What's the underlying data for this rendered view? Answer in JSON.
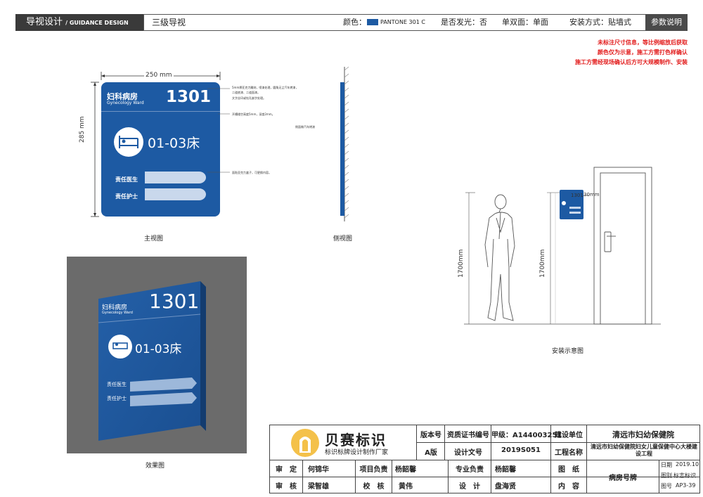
{
  "header": {
    "brand": "导视设计",
    "brand_sub": "/ GUIDANCE DESIGN",
    "page": "三级导视",
    "color_label": "颜色：",
    "pantone": "PANTONE 301 C",
    "glow": "是否发光：否",
    "sides": "单双面：单面",
    "mount": "安装方式：贴墙式",
    "ref_button": "参数说明"
  },
  "notes": [
    "未标注尺寸信息，等比例缩放后获取",
    "颜色仅为示意，施工方需打色样确认",
    "施工方需经现场确认后方可大规模制作、安装"
  ],
  "sign": {
    "dept_cn": "妇科病房",
    "dept_en": "Gynecology Ward",
    "room": "1301",
    "beds": "01-03床",
    "doctor": "责任医生",
    "nurse": "责任护士"
  },
  "front_view": {
    "width_dim": "250 mm",
    "height_dim": "285 mm",
    "caption": "主视图",
    "annotations": [
      "5mm厚亚克力雕刻，喷漆处理，圆角无尘汽车烤漆，",
      "二道底漆、二道面漆。",
      "文字丝印或钻孔嵌字处理。",
      "开槽镂空高度5mm，深度2mm。",
      "面贴亚克力盒子，可更换内容。"
    ]
  },
  "side_view": {
    "caption": "侧视图",
    "annotation": "侧面做汽车烤漆"
  },
  "install": {
    "height_person": "1700mm",
    "height_sign": "1700mm",
    "gap": "30mm",
    "caption": "安装示意图"
  },
  "effect": {
    "caption": "效果图"
  },
  "title_block": {
    "logo_name": "贝赛标识",
    "logo_sub": "标识标牌设计制作厂家",
    "version_label": "版本号",
    "version": "A版",
    "cert_label": "资质证书编号",
    "design_no_label": "设计文号",
    "grade": "甲级：A144003251",
    "design_no": "2019S051",
    "client_label": "建设单位",
    "client": "清远市妇幼保健院",
    "project_label": "工程名称",
    "project": "清远市妇幼保健院妇女儿童保健中心大楼建设工程",
    "approve_label": "审　定",
    "approve": "何锦华",
    "review_label": "审　核",
    "review": "梁智雄",
    "pm_label": "项目负责",
    "pm": "杨韶馨",
    "check_label": "校　核",
    "check": "黄伟",
    "pro_label": "专业负责",
    "pro": "杨韶馨",
    "design_label": "设　计",
    "designer": "盘海贤",
    "drawing_label": "图　纸",
    "content_label": "内　容",
    "drawing": "病房号牌",
    "date_label": "日期",
    "date": "2019.10",
    "type_label": "图别",
    "type": "标志标识",
    "no_label": "图号",
    "no": "AP3-39"
  }
}
